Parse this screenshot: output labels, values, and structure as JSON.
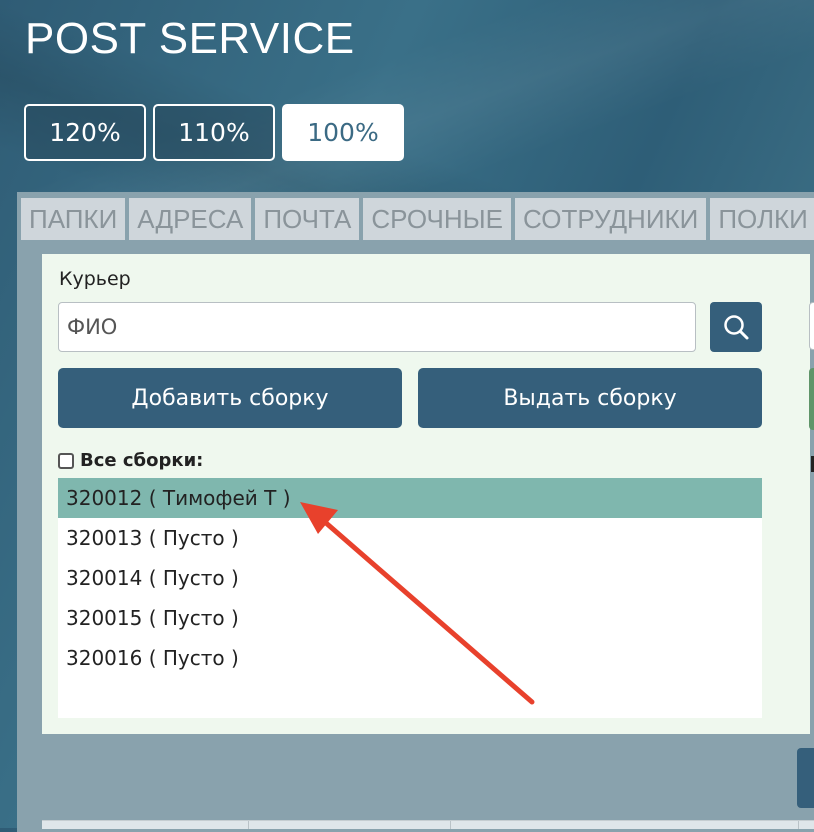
{
  "app": {
    "title": "POST SERVICE"
  },
  "zoom": {
    "options": [
      {
        "label": "120%",
        "active": false
      },
      {
        "label": "110%",
        "active": false
      },
      {
        "label": "100%",
        "active": true
      }
    ]
  },
  "tabs": [
    "ПАПКИ",
    "АДРЕСА",
    "ПОЧТА",
    "СРОЧНЫЕ",
    "СОТРУДНИКИ",
    "ПОЛКИ"
  ],
  "courier": {
    "label": "Курьер",
    "placeholder": "ФИО",
    "search_icon": "search-icon"
  },
  "actions": {
    "add_label": "Добавить сборку",
    "issue_label": "Выдать сборку"
  },
  "assemblies": {
    "all_label": "Все сборки:",
    "all_checked": false,
    "items": [
      {
        "text": "320012 ( Тимофей Т )",
        "selected": true
      },
      {
        "text": "320013 ( Пусто )",
        "selected": false
      },
      {
        "text": "320014 ( Пусто )",
        "selected": false
      },
      {
        "text": "320015 ( Пусто )",
        "selected": false
      },
      {
        "text": "320016 ( Пусто )",
        "selected": false
      }
    ]
  },
  "colors": {
    "primary": "#355f7b",
    "selected_row": "#7fb7ae",
    "card_bg": "#eff8ee",
    "annotation_arrow": "#e8412c"
  }
}
